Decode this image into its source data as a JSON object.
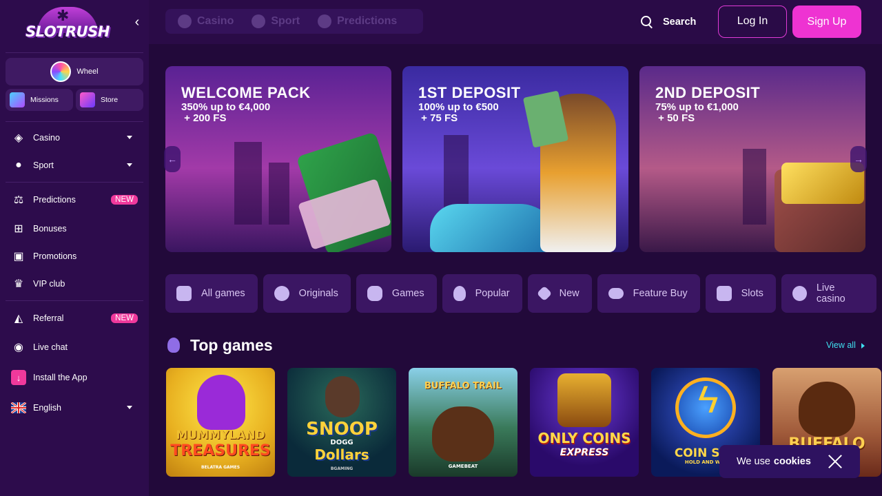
{
  "brand": {
    "logo_text": "SLOTRUSH"
  },
  "sidebar": {
    "wheel_label": "Wheel",
    "missions_label": "Missions",
    "store_label": "Store",
    "items": [
      {
        "label": "Casino",
        "icon": "casino-chip-icon"
      },
      {
        "label": "Sport",
        "icon": "ball-icon"
      },
      {
        "label": "Predictions",
        "icon": "scales-icon",
        "badge": "NEW"
      },
      {
        "label": "Bonuses",
        "icon": "gift-icon"
      },
      {
        "label": "Promotions",
        "icon": "ticket-icon"
      },
      {
        "label": "VIP club",
        "icon": "crown-icon"
      },
      {
        "label": "Referral",
        "icon": "megaphone-icon",
        "badge": "NEW"
      },
      {
        "label": "Live chat",
        "icon": "chat-icon"
      },
      {
        "label": "Install the App",
        "icon": "download-icon"
      },
      {
        "label": "English",
        "icon": "uk-flag-icon"
      }
    ]
  },
  "topbar": {
    "tabs": [
      "Casino",
      "Sport",
      "Predictions"
    ],
    "search_label": "Search",
    "login_label": "Log In",
    "signup_label": "Sign Up"
  },
  "banners": [
    {
      "title": "WELCOME PACK",
      "subtitle": "350% up to €4,000\n + 200 FS"
    },
    {
      "title": "1ST DEPOSIT",
      "subtitle": "100% up to €500\n + 75 FS"
    },
    {
      "title": "2ND DEPOSIT",
      "subtitle": "75% up to €1,000\n + 50 FS"
    }
  ],
  "categories": [
    "All games",
    "Originals",
    "Games",
    "Popular",
    "New",
    "Feature Buy",
    "Slots",
    "Live casino"
  ],
  "top_games": {
    "title": "Top games",
    "view_all": "View all",
    "games": [
      {
        "l1": "MUMMYLAND",
        "l2": "TREASURES",
        "provider": "BELATRA GAMES"
      },
      {
        "l1": "SNOOP",
        "l2": "Dollars",
        "small": "DOGG",
        "provider": "BGAMING"
      },
      {
        "l1": "BUFFALO TRAIL",
        "provider": "GAMEBEAT"
      },
      {
        "l1": "ONLY COINS",
        "l2": "EXPRESS"
      },
      {
        "l1": "COIN STR",
        "l2": "HOLD AND WIN"
      },
      {
        "l1": "BUFFALO"
      }
    ]
  },
  "cookie": {
    "text": "We use",
    "bold": "cookies"
  },
  "colors": {
    "accent_pink": "#ee33d2",
    "badge_pink": "#f0399c",
    "link_cyan": "#3fe0f0",
    "sidebar_bg": "#2d0c4c",
    "main_bg": "#22093a"
  }
}
